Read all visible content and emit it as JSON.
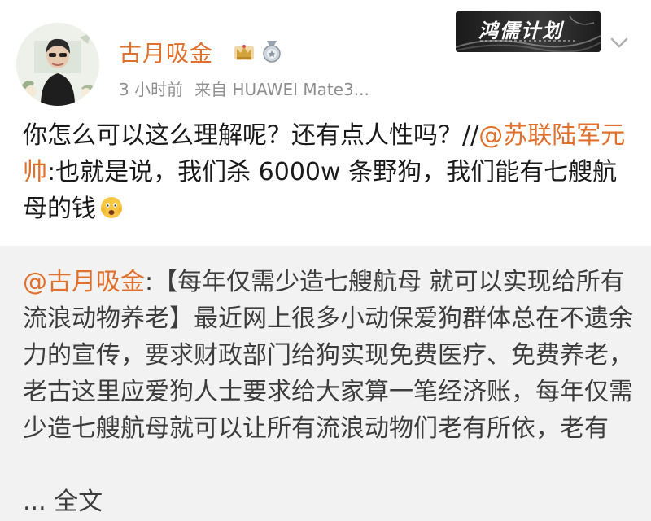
{
  "post": {
    "username": "古月吸金",
    "time_ago": "3 小时前",
    "source": "来自 HUAWEI Mate3...",
    "text_before": "你怎么可以这么理解呢？还有点人性吗？//",
    "mention": "@苏联陆军元帅",
    "text_after": ":也就是说，我们杀 6000w 条野狗，我们能有七艘航母的钱"
  },
  "watermark": {
    "label": "鸿儒计划"
  },
  "repost": {
    "author": "@古月吸金",
    "text": ":【每年仅需少造七艘航母 就可以实现给所有流浪动物养老】最近网上很多小动保爱狗群体总在不遗余力的宣传，要求财政部门给狗实现免费医疗、免费养老，老古这里应爱狗人士要求给大家算一笔经济账，每年仅需少造七艘航母就可以让所有流浪动物们老有所依，老有",
    "ellipsis": "...",
    "more_label": "全文"
  },
  "icons": {
    "badge_crown": "crown-badge-icon",
    "badge_medal": "medal-badge-icon",
    "emoji": "scared-face-emoji-icon",
    "chevron": "chevron-down-icon"
  },
  "colors": {
    "username": "#e0702b",
    "mention": "#e0702b",
    "repost_bg": "#f2f2f2",
    "meta": "#8e8e8e"
  }
}
